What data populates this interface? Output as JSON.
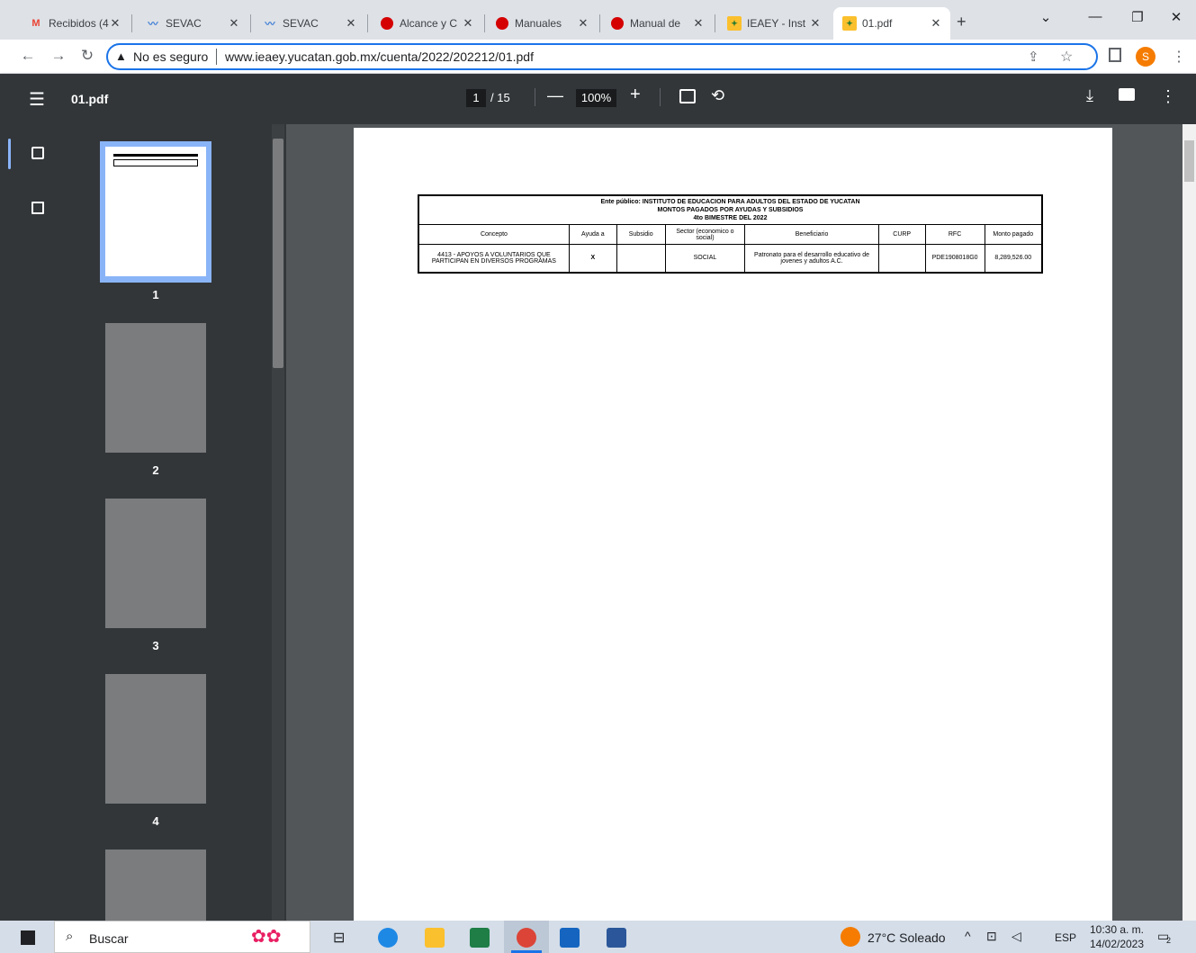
{
  "browser": {
    "tabs": [
      {
        "title": "Recibidos (4",
        "icon": "gmail-icon"
      },
      {
        "title": "SEVAC",
        "icon": "sevac-icon"
      },
      {
        "title": "SEVAC",
        "icon": "sevac-icon"
      },
      {
        "title": "Alcance y C",
        "icon": "red-circle-icon"
      },
      {
        "title": "Manuales",
        "icon": "red-circle-icon"
      },
      {
        "title": "Manual de",
        "icon": "red-circle-icon"
      },
      {
        "title": "IEAEY - Inst",
        "icon": "ieaey-icon"
      },
      {
        "title": "01.pdf",
        "icon": "ieaey-icon",
        "active": true
      }
    ],
    "security_label": "No es seguro",
    "url": "www.ieaey.yucatan.gob.mx/cuenta/2022/202212/01.pdf",
    "profile_initial": "S"
  },
  "pdf": {
    "title": "01.pdf",
    "current_page": "1",
    "total_pages": "/ 15",
    "zoom": "100%",
    "thumb_labels": [
      "1",
      "2",
      "3",
      "4"
    ]
  },
  "document": {
    "header_line1": "Ente público: INSTITUTO DE EDUCACION PARA ADULTOS DEL ESTADO DE YUCATAN",
    "header_line2": "MONTOS PAGADOS POR AYUDAS Y SUBSIDIOS",
    "header_line3": "4to BIMESTRE DEL 2022",
    "columns": [
      "Concepto",
      "Ayuda a",
      "Subsidio",
      "Sector (economico o social)",
      "Beneficiario",
      "CURP",
      "RFC",
      "Monto pagado"
    ],
    "row": {
      "concepto": "4413 - APOYOS A VOLUNTARIOS QUE PARTICIPAN EN DIVERSOS PROGRAMAS",
      "ayuda": "X",
      "subsidio": "",
      "sector": "SOCIAL",
      "beneficiario": "Patronato para el desarrollo educativo de jovenes y adultos A.C.",
      "curp": "",
      "rfc": "PDE1908018G0",
      "monto": "8,289,526.00"
    }
  },
  "taskbar": {
    "search_label": "Buscar",
    "weather": "27°C  Soleado",
    "language": "ESP",
    "time": "10:30 a. m.",
    "date": "14/02/2023",
    "notifications": "2"
  },
  "colors": {
    "accent": "#1a73e8",
    "pdf_toolbar": "#323639",
    "profile": "#f57c00"
  }
}
